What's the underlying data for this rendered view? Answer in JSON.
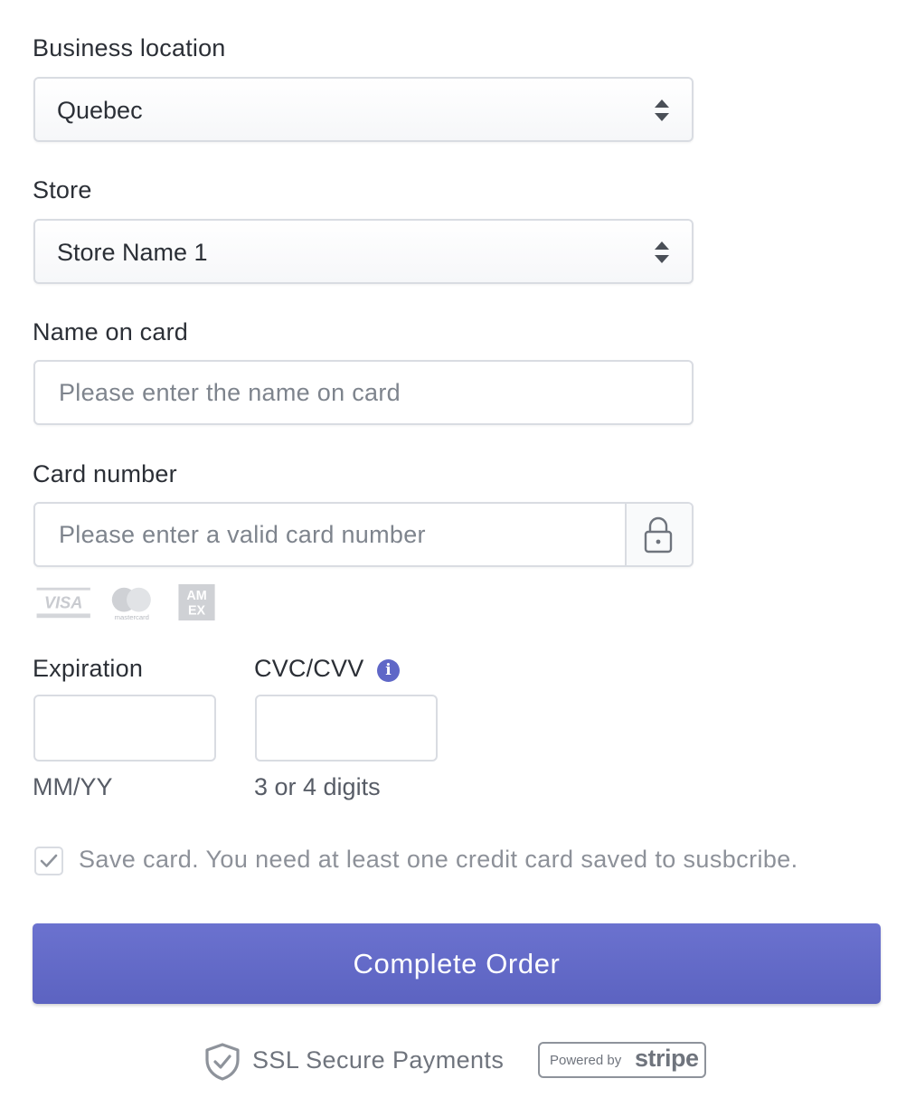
{
  "business_location": {
    "label": "Business location",
    "value": "Quebec"
  },
  "store": {
    "label": "Store",
    "value": "Store Name 1"
  },
  "name_on_card": {
    "label": "Name on card",
    "placeholder": "Please enter the name on card",
    "value": ""
  },
  "card_number": {
    "label": "Card number",
    "placeholder": "Please enter a valid card number",
    "value": "",
    "lock_icon": "lock-icon"
  },
  "card_brands": {
    "visa": "VISA",
    "mastercard": "mastercard",
    "amex": "AMEX"
  },
  "expiration": {
    "label": "Expiration",
    "value": "",
    "hint": "MM/YY"
  },
  "cvc": {
    "label": "CVC/CVV",
    "value": "",
    "hint": "3 or 4 digits",
    "info_icon": "info-icon"
  },
  "save_card": {
    "checked": true,
    "text": "Save card. You need at least one credit card saved to susbcribe."
  },
  "submit": {
    "label": "Complete Order",
    "color": "#6168c8"
  },
  "footer": {
    "ssl_text": "SSL Secure Payments",
    "powered_by": "Powered by",
    "stripe": "stripe",
    "shield_icon": "shield-check-icon"
  }
}
